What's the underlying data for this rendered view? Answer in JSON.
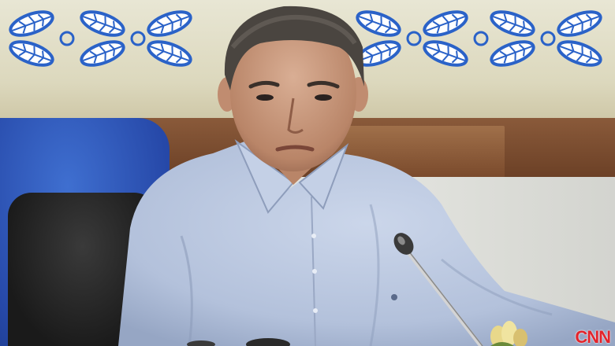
{
  "scene": {
    "description_colors": {
      "banner": "#dcd8bd",
      "pattern": "#2a62c8",
      "wood": "#7a4a2c",
      "chair_blue": "#2648a8",
      "chair_black": "#1a1a1a",
      "shirt": "#b8c6de",
      "skin": "#c89a80",
      "hair": "#4a4540"
    },
    "icons": [
      "microphone-icon",
      "leaf-pattern-icon",
      "flower-icon"
    ]
  },
  "logo": {
    "text": "CNN",
    "color": "#e3242b"
  }
}
